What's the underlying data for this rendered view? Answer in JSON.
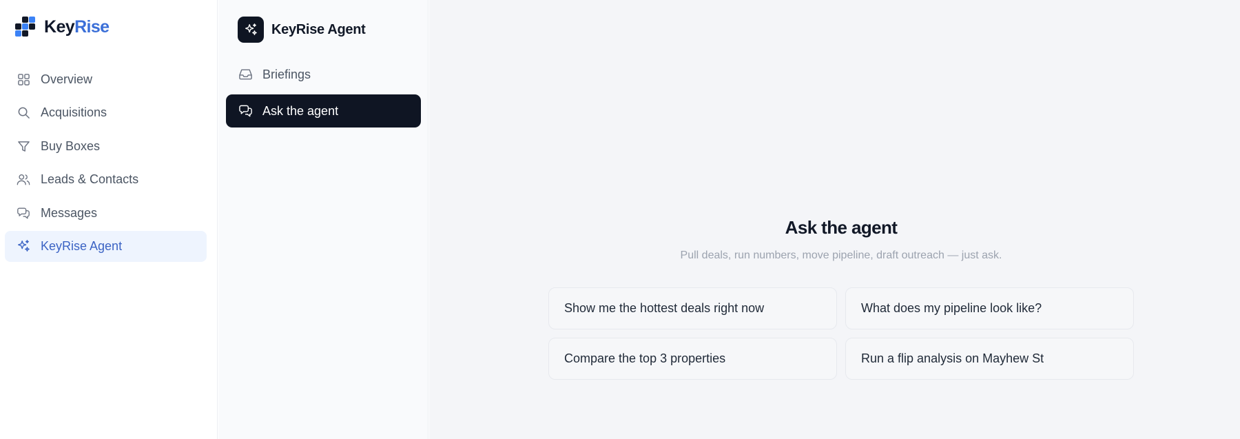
{
  "brand": {
    "name_part1": "Key",
    "name_part2": "Rise",
    "logo_icon": "keyrise-logo",
    "accent_color": "#3b6fd8"
  },
  "sidebar": {
    "items": [
      {
        "label": "Overview",
        "icon": "grid-icon"
      },
      {
        "label": "Acquisitions",
        "icon": "search-icon"
      },
      {
        "label": "Buy Boxes",
        "icon": "filter-icon"
      },
      {
        "label": "Leads & Contacts",
        "icon": "users-icon"
      },
      {
        "label": "Messages",
        "icon": "chat-icon"
      },
      {
        "label": "KeyRise Agent",
        "icon": "sparkles-icon",
        "active": true
      }
    ]
  },
  "panel": {
    "title": "KeyRise Agent",
    "icon": "sparkles-icon",
    "items": [
      {
        "label": "Briefings",
        "icon": "inbox-icon"
      },
      {
        "label": "Ask the agent",
        "icon": "chat-icon",
        "active": true
      }
    ]
  },
  "main": {
    "title": "Ask the agent",
    "subtitle": "Pull deals, run numbers, move pipeline, draft outreach — just ask.",
    "suggestions": [
      "Show me the hottest deals right now",
      "What does my pipeline look like?",
      "Compare the top 3 properties",
      "Run a flip analysis on Mayhew St"
    ]
  },
  "colors": {
    "dark": "#0f1523",
    "active_bg": "#eef4fe",
    "active_text": "#3b63c4",
    "main_bg": "#f4f5f8"
  }
}
